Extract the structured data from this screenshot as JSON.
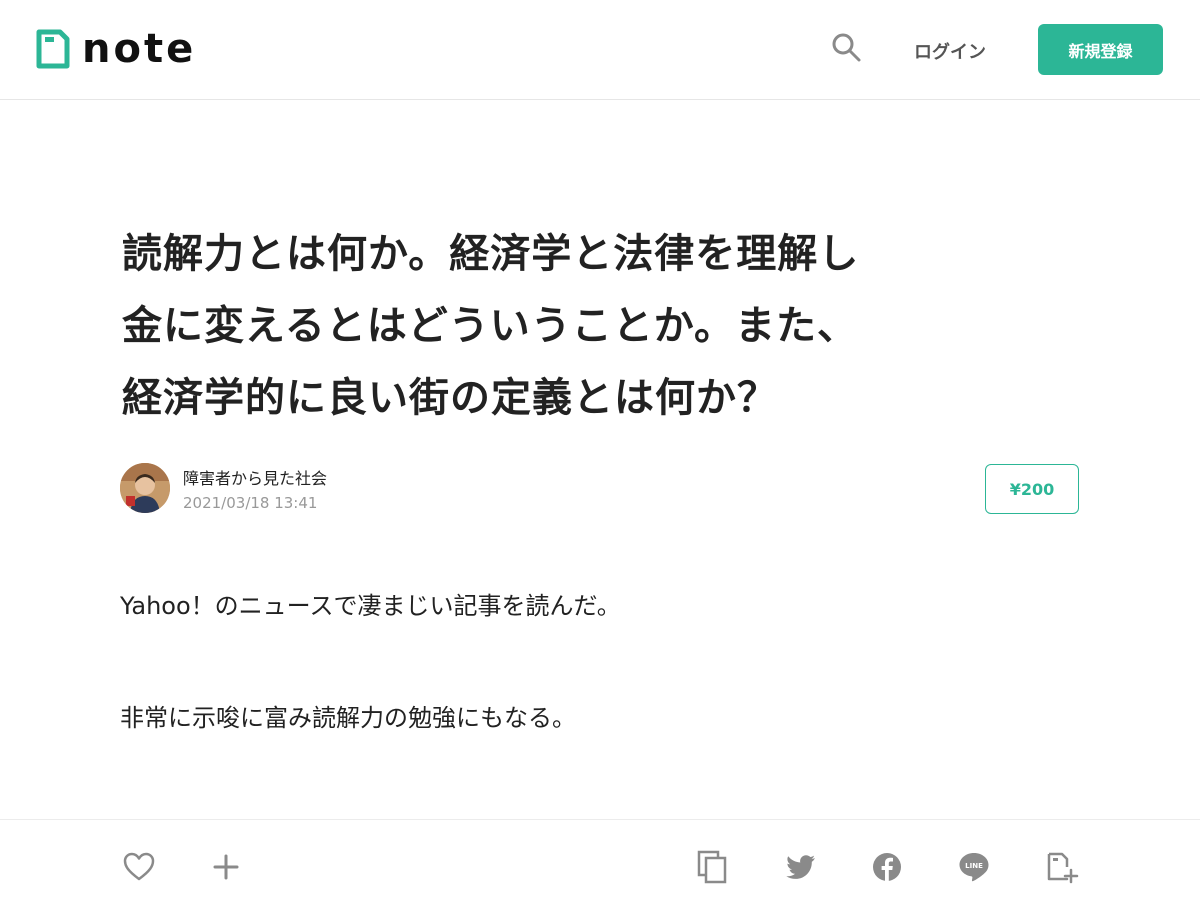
{
  "header": {
    "logo_text": "note",
    "login_label": "ログイン",
    "signup_label": "新規登録"
  },
  "article": {
    "title_lines": [
      "読解力とは何か。経済学と法律を理解し",
      "金に変えるとはどういうことか。また、",
      "経済学的に良い街の定義とは何か？"
    ],
    "author_name": "障害者から見た社会",
    "date": "2021/03/18 13:41",
    "price": "¥200",
    "paragraphs": [
      "Yahoo！のニュースで凄まじい記事を読んだ。",
      "非常に示唆に富み読解力の勉強にもなる。"
    ]
  },
  "footer_icons": [
    "heart-icon",
    "plus-icon",
    "copy-icon",
    "twitter-icon",
    "facebook-icon",
    "line-icon",
    "embed-icon"
  ],
  "colors": {
    "accent": "#2cb696",
    "text": "#222222",
    "muted": "#999999",
    "icon": "#8a8a8a"
  }
}
